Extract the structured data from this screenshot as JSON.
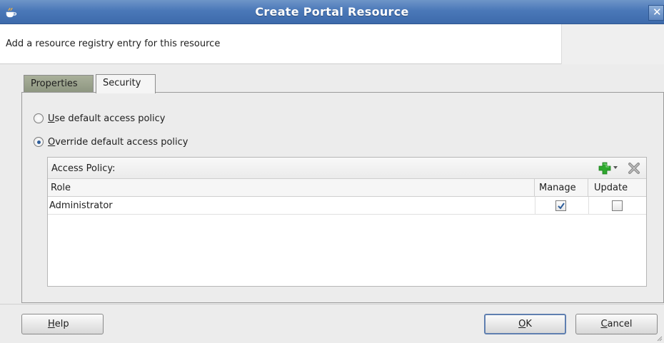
{
  "window": {
    "title": "Create Portal Resource",
    "close_glyph": "✕"
  },
  "description": {
    "text": "Add a resource registry entry for this resource"
  },
  "tabs": [
    {
      "label": "Properties",
      "selected": false
    },
    {
      "label": "Security",
      "selected": true
    }
  ],
  "security": {
    "option_default": {
      "mnemonic": "U",
      "rest": "se default access policy",
      "checked": false
    },
    "option_override": {
      "mnemonic": "O",
      "rest": "verride default access policy",
      "checked": true
    },
    "access_policy": {
      "label": "Access Policy:",
      "toolbar_icons": [
        "add-icon",
        "dropdown-arrow-icon",
        "delete-icon"
      ],
      "columns": [
        "Role",
        "Manage",
        "Update"
      ],
      "rows": [
        {
          "role": "Administrator",
          "manage": true,
          "update": false
        }
      ]
    }
  },
  "buttons": {
    "help": {
      "mnemonic": "H",
      "rest": "elp"
    },
    "ok": {
      "mnemonic": "O",
      "rest": "K"
    },
    "cancel": {
      "mnemonic": "C",
      "rest": "ancel"
    }
  },
  "colors": {
    "titlebar": "#4a78b8",
    "add_icon_green": "#2ea82e",
    "checkmark_blue": "#2d5d9a"
  }
}
